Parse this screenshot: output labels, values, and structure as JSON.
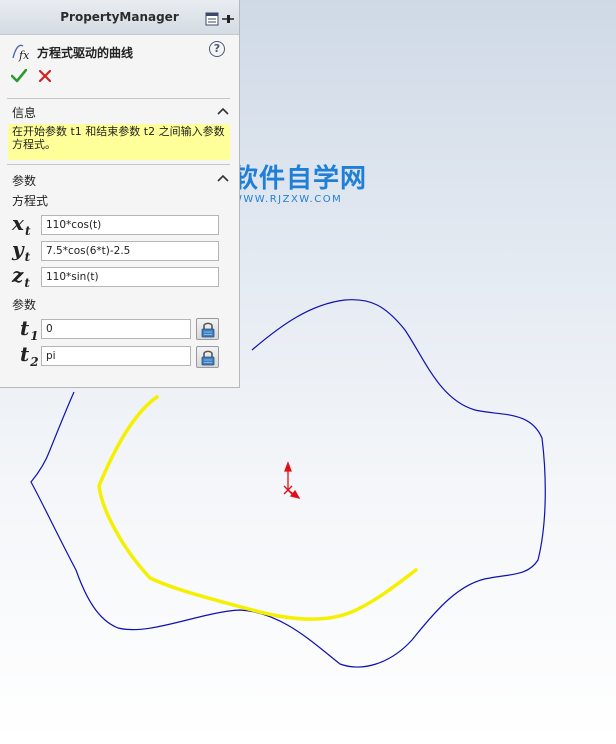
{
  "property_manager": {
    "title": "PropertyManager",
    "feature_title": "方程式驱动的曲线",
    "help_icon": "help-circle-icon",
    "help_glyph": "?",
    "ok_icon": "checkmark-icon",
    "cancel_icon": "close-x-icon"
  },
  "info_section": {
    "label": "信息",
    "message": "在开始参数 t1 和结束参数 t2 之间输入参数方程式。"
  },
  "params_section": {
    "label": "参数",
    "equations_label": "方程式",
    "equations": [
      {
        "var": "x",
        "sub": "t",
        "value": "110*cos(t)"
      },
      {
        "var": "y",
        "sub": "t",
        "value": "7.5*cos(6*t)-2.5"
      },
      {
        "var": "z",
        "sub": "t",
        "value": "110*sin(t)"
      }
    ],
    "parameters_label": "参数",
    "parameters": [
      {
        "var": "t",
        "sub": "1",
        "value": "0"
      },
      {
        "var": "t",
        "sub": "2",
        "value": "pi"
      }
    ]
  },
  "watermark": {
    "title": "软件自学网",
    "url": "WWW.RJZXW.COM"
  },
  "colors": {
    "full_curve": "#1010b0",
    "preview_curve": "#f5f000",
    "origin": "#e0101a",
    "watermark": "#1f7fd6",
    "message_bg": "#ffff99"
  }
}
